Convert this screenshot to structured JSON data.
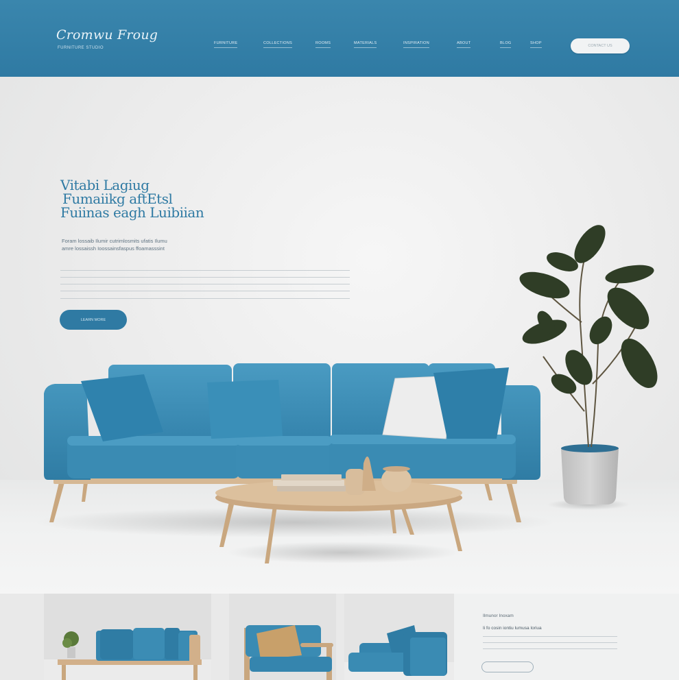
{
  "brand": {
    "logo_text": "Cromwu Froug",
    "tagline": "FURNITURE STUDIO"
  },
  "nav": {
    "items": [
      {
        "label": "FURNITURE"
      },
      {
        "label": "COLLECTIONS"
      },
      {
        "label": "ROOMS"
      },
      {
        "label": "MATERIALS"
      },
      {
        "label": "INSPIRATION"
      },
      {
        "label": "ABOUT"
      },
      {
        "label": "BLOG"
      },
      {
        "label": "SHOP"
      }
    ],
    "cta_label": "CONTACT US"
  },
  "hero": {
    "headline_lines": [
      "Vitabi Lagiug",
      "Fumaiikg aftEtsl",
      "Fuiinas eagh Luibiian"
    ],
    "subtext_lines": [
      "Foram lossaib Ilumir cutrimlosmits ufatis Ilumu",
      "amre lossaissh Ioossainsfaspus ffoamasssint"
    ],
    "cta_label": "LEARN MORE"
  },
  "info_card": {
    "title": "Ilmunor Inoxam",
    "line": "Ii fo cosin iontiu lumusa Ioriua"
  },
  "colors": {
    "header": "#2f7aa3",
    "accent": "#2f7aa3",
    "sofa": "#3a8db4",
    "wood": "#c9a77f"
  }
}
